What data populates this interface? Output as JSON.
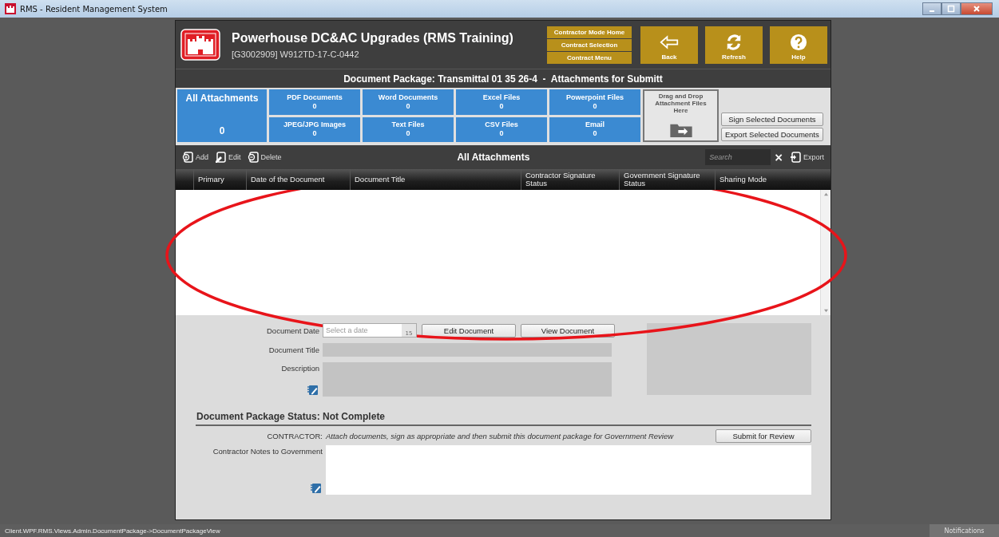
{
  "window": {
    "title": "RMS - Resident Management System"
  },
  "header": {
    "title": "Powerhouse DC&AC Upgrades (RMS Training)",
    "subtitle": "[G3002909] W912TD-17-C-0442",
    "nav_links": [
      "Contractor Mode Home",
      "Contract Selection",
      "Contract Menu"
    ],
    "buttons": [
      {
        "kind": "back",
        "label": "Back"
      },
      {
        "kind": "refresh",
        "label": "Refresh"
      },
      {
        "kind": "help",
        "label": "Help"
      }
    ]
  },
  "package_title": "Document Package: Transmittal 01 35 26-4  -  Attachments for Submitt",
  "tiles": {
    "all": {
      "label": "All Attachments",
      "count": "0",
      "selected": true
    },
    "categories": [
      {
        "label": "PDF Documents",
        "count": "0"
      },
      {
        "label": "Word Documents",
        "count": "0"
      },
      {
        "label": "Excel Files",
        "count": "0"
      },
      {
        "label": "Powerpoint Files",
        "count": "0"
      },
      {
        "label": "JPEG/JPG Images",
        "count": "0"
      },
      {
        "label": "Text Files",
        "count": "0"
      },
      {
        "label": "CSV Files",
        "count": "0"
      },
      {
        "label": "Email",
        "count": "0"
      }
    ],
    "drop_zone": "Drag and Drop Attachment Files Here",
    "actions": [
      "Sign Selected Documents",
      "Export Selected Documents"
    ]
  },
  "toolbar": {
    "actions": [
      {
        "kind": "add",
        "label": "Add"
      },
      {
        "kind": "edit",
        "label": "Edit"
      },
      {
        "kind": "delete",
        "label": "Delete"
      }
    ],
    "title": "All Attachments",
    "search": {
      "placeholder": "Search"
    },
    "clear": "×",
    "export": "Export"
  },
  "table": {
    "columns": [
      "Primary",
      "Date of the Document",
      "Document Title",
      "Contractor Signature Status",
      "Government Signature Status",
      "Sharing Mode"
    ]
  },
  "form": {
    "date_label": "Document Date",
    "date_placeholder": "Select a date",
    "date_day": "15",
    "buttons": [
      "Edit Document",
      "View Document"
    ],
    "title_label": "Document Title",
    "description_label": "Description"
  },
  "status": {
    "heading": "Document Package Status: Not Complete",
    "contractor_label": "CONTRACTOR:",
    "contractor_text": "Attach documents, sign as appropriate and then submit this document package for Government Review",
    "submit": "Submit for Review",
    "notes_label": "Contractor Notes to Government"
  },
  "status_bar": {
    "path": "Client.WPF.RMS.Views.Admin.DocumentPackage->DocumentPackageView",
    "notifications": "Notifications"
  }
}
